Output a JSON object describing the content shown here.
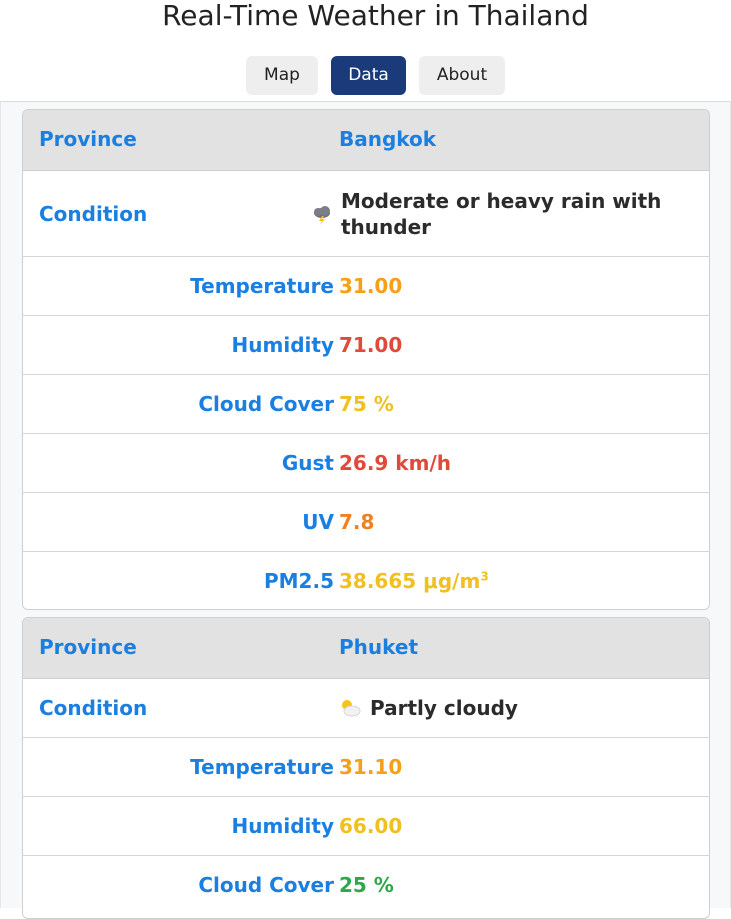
{
  "page": {
    "title": "Real-Time Weather in Thailand"
  },
  "nav": {
    "map": "Map",
    "data": "Data",
    "about": "About",
    "active": "Data"
  },
  "labels": {
    "province": "Province",
    "condition": "Condition",
    "temperature": "Temperature",
    "humidity": "Humidity",
    "cloud_cover": "Cloud Cover",
    "gust": "Gust",
    "uv": "UV",
    "pm25": "PM2.5"
  },
  "cards": [
    {
      "province": "Bangkok",
      "condition": "Moderate or heavy rain with thunder",
      "condition_icon": "thunderstorm-icon",
      "temperature": "31.00",
      "temperature_color": "#f5a01a",
      "humidity": "71.00",
      "humidity_color": "#e04a3a",
      "cloud_cover": "75 %",
      "cloud_cover_color": "#f0c020",
      "gust": "26.9 km/h",
      "gust_color": "#e04a3a",
      "uv": "7.8",
      "uv_color": "#f08020",
      "pm25": "38.665 μg/m",
      "pm25_sup": "3",
      "pm25_color": "#f0c020"
    },
    {
      "province": "Phuket",
      "condition": "Partly cloudy",
      "condition_icon": "partly-cloudy-icon",
      "temperature": "31.10",
      "temperature_color": "#f5a01a",
      "humidity": "66.00",
      "humidity_color": "#f0c020",
      "cloud_cover": "25 %",
      "cloud_cover_color": "#2ea84a"
    }
  ]
}
